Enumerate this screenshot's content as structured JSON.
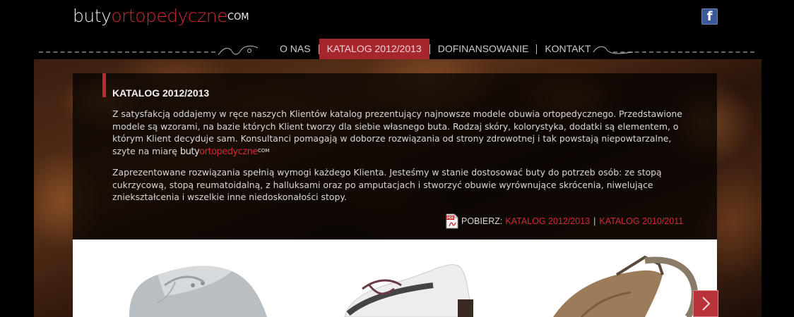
{
  "header": {
    "logo": {
      "part1": "buty",
      "part2": "ortopedyczne",
      "part3": "COM"
    },
    "facebook_label": "f"
  },
  "nav": {
    "items": [
      {
        "label": "O NAS"
      },
      {
        "label": "KATALOG 2012/2013",
        "active": true
      },
      {
        "label": "DOFINANSOWANIE"
      },
      {
        "label": "KONTAKT"
      }
    ]
  },
  "content": {
    "title": "KATALOG 2012/2013",
    "paragraph1": "Z satysfakcją oddajemy w ręce naszych Klientów katalog prezentujący najnowsze modele obuwia ortopedycznego. Przedstawione modele są wzorami, na bazie których Klient tworzy dla siebie własnego buta. Rodzaj skóry, kolorystyka, dodatki są elementem, o którym Klient decyduje sam. Konsultanci pomagają w doborze rozwiązania od strony zdrowotnej i tak powstają niepowtarzalne, szyte na miarę",
    "paragraph2": "Zaprezentowane rozwiązania spełnią wymogi każdego Klienta. Jesteśmy w stanie dostosować buty do potrzeb osób: ze stopą cukrzycową, stopą reumatoidalną, z halluksami oraz po amputacjach i stworzyć obuwie wyrównujące skrócenia, niwelujące zniekształcenia i wszelkie inne niedoskonałości stopy.",
    "download": {
      "label": "POBIERZ:",
      "link1": "KATALOG 2012/2013",
      "separator": "|",
      "link2": "KATALOG 2010/2011"
    }
  },
  "colors": {
    "accent": "#a5262c",
    "link": "#d12b35",
    "facebook": "#3b5998"
  }
}
